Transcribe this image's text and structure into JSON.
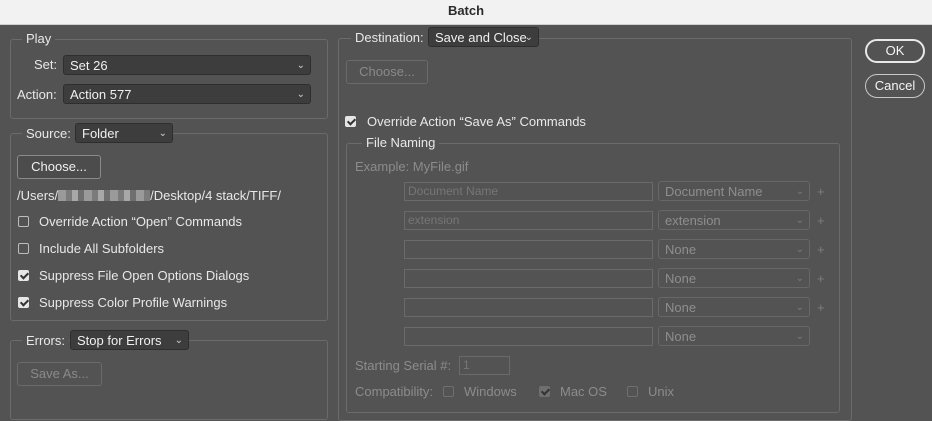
{
  "window": {
    "title": "Batch"
  },
  "play": {
    "legend": "Play",
    "set_label": "Set:",
    "set_value": "Set 26",
    "action_label": "Action:",
    "action_value": "Action 577"
  },
  "source": {
    "label": "Source:",
    "value": "Folder",
    "choose_button": "Choose...",
    "path_prefix": "/Users/",
    "path_suffix": "/Desktop/4 stack/TIFF/",
    "options": [
      {
        "label": "Override Action “Open” Commands",
        "checked": false
      },
      {
        "label": "Include All Subfolders",
        "checked": false
      },
      {
        "label": "Suppress File Open Options Dialogs",
        "checked": true
      },
      {
        "label": "Suppress Color Profile Warnings",
        "checked": true
      }
    ]
  },
  "errors": {
    "label": "Errors:",
    "value": "Stop for Errors",
    "save_as_button": "Save As..."
  },
  "destination": {
    "label": "Destination:",
    "value": "Save and Close",
    "choose_button": "Choose...",
    "override_label": "Override Action “Save As” Commands",
    "override_checked": true
  },
  "file_naming": {
    "legend": "File Naming",
    "example": "Example: MyFile.gif",
    "rows": [
      {
        "field": "Document Name",
        "select": "Document Name"
      },
      {
        "field": "extension",
        "select": "extension"
      },
      {
        "field": "",
        "select": "None"
      },
      {
        "field": "",
        "select": "None"
      },
      {
        "field": "",
        "select": "None"
      },
      {
        "field": "",
        "select": "None"
      }
    ],
    "plus_glyph": "+",
    "serial_label": "Starting Serial #:",
    "serial_value": "1",
    "compat_label": "Compatibility:",
    "compat": [
      {
        "label": "Windows",
        "checked": false
      },
      {
        "label": "Mac OS",
        "checked": true
      },
      {
        "label": "Unix",
        "checked": false
      }
    ]
  },
  "actions": {
    "ok": "OK",
    "cancel": "Cancel"
  },
  "icons": {
    "chevron": "chevron-down-icon",
    "checkbox": "checkmark-icon",
    "add": "plus-icon"
  }
}
